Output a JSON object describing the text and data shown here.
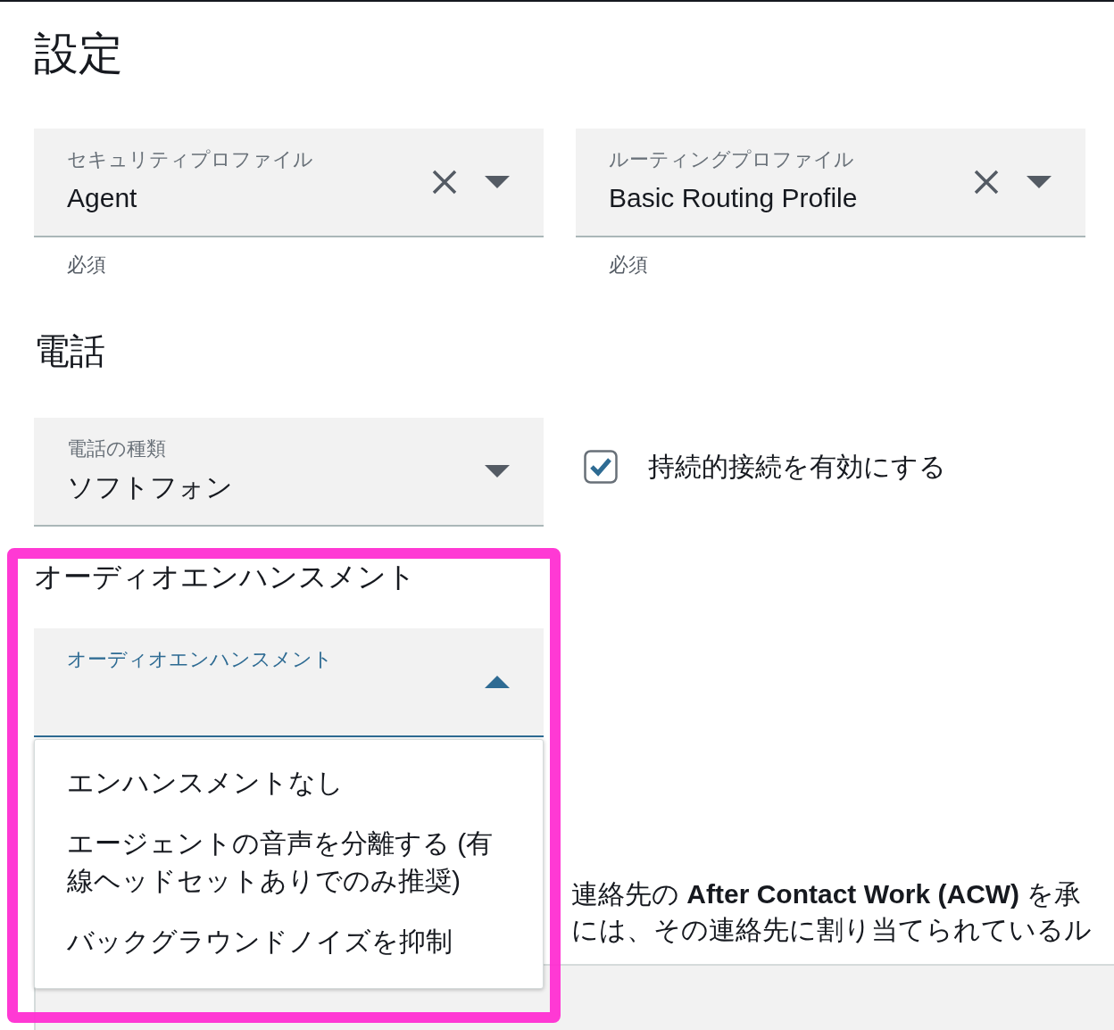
{
  "page_title": "設定",
  "profile_fields": [
    {
      "label": "セキュリティプロファイル",
      "value": "Agent",
      "hint": "必須",
      "clearable": true
    },
    {
      "label": "ルーティングプロファイル",
      "value": "Basic Routing Profile",
      "hint": "必須",
      "clearable": true
    }
  ],
  "phone_section": {
    "title": "電話",
    "phone_type": {
      "label": "電話の種類",
      "value": "ソフトフォン"
    },
    "persistent_connection": {
      "label": "持続的接続を有効にする",
      "checked": true
    }
  },
  "audio_enhancement": {
    "title": "オーディオエンハンスメント",
    "field_label": "オーディオエンハンスメント",
    "expanded": true,
    "options": [
      {
        "label": "エンハンスメントなし"
      },
      {
        "label": "エージェントの音声を分離する (有線ヘッドセットありでのみ推奨)"
      },
      {
        "label": "バックグラウンドノイズを抑制"
      }
    ]
  },
  "partly_hidden_text": [
    "連絡先の **After Contact Work (ACW)** を承",
    "には、その連絡先に割り当てられているル"
  ]
}
